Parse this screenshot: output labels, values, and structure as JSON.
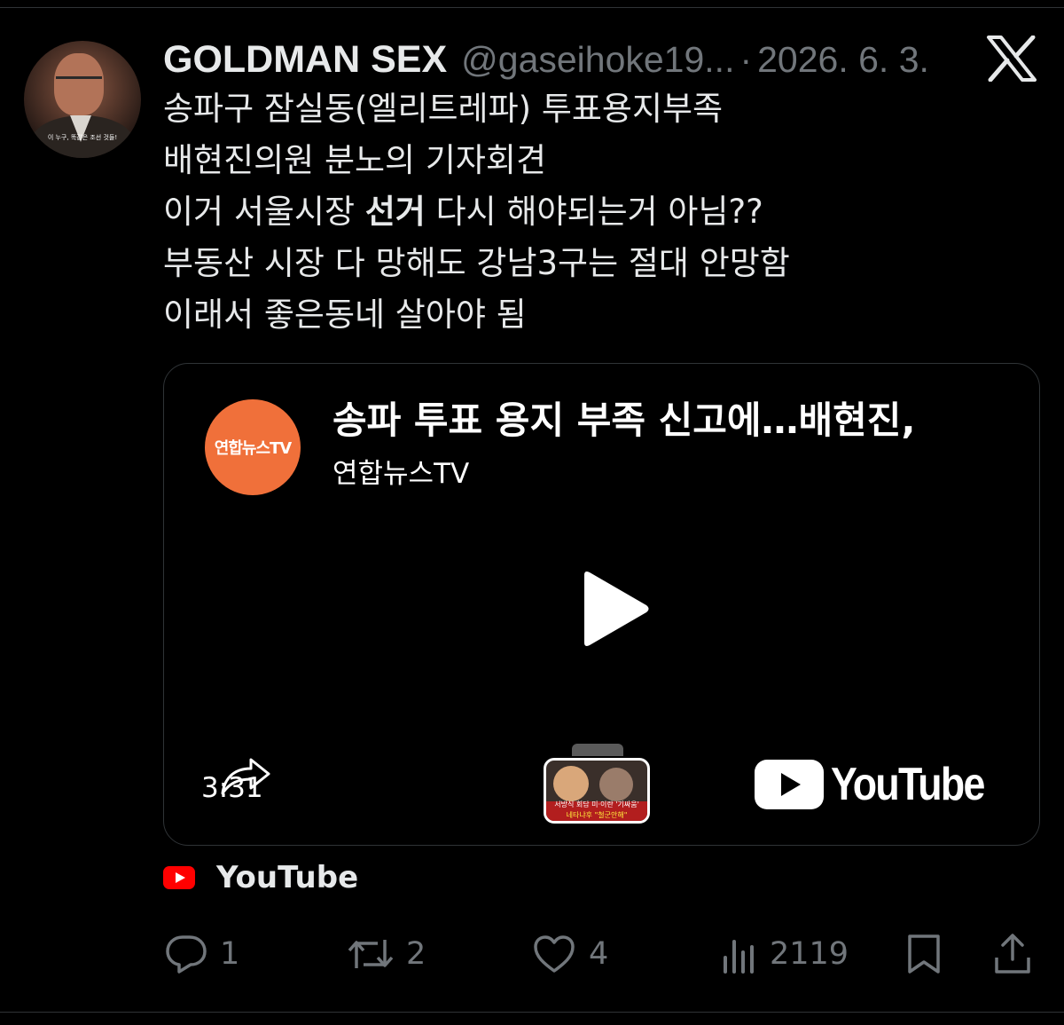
{
  "post": {
    "display_name": "GOLDMAN SEX",
    "handle": "@gaseihoke19...",
    "separator": "·",
    "date": "2026. 6. 3.",
    "avatar_caption": "이 누구, 똑같은 조선 것들!",
    "text_lines": [
      "송파구 잠실동(엘리트레파) 투표용지부족",
      "배현진의원 분노의 기자회견"
    ],
    "line3": {
      "before": "이거 서울시장 ",
      "bold": "선거",
      "after": " 다시 해야되는거 아님??"
    },
    "text_lines_2": [
      "부동산 시장 다 망해도 강남3구는 절대 안망함",
      "이래서 좋은동네 살아야 됨"
    ]
  },
  "video_card": {
    "channel_logo_text": "연합뉴스TV",
    "title": "송파 투표 용지 부족 신고에…배현진,",
    "channel_name": "연합뉴스TV",
    "duration": "3:31",
    "thumbnail_line1": "서방식 회담 미·이란 '기싸움'",
    "thumbnail_line2": "네타냐후 \"철군안해\"",
    "youtube_wordmark": "YouTube"
  },
  "source_label": "YouTube",
  "actions": {
    "replies": "1",
    "reposts": "2",
    "likes": "4",
    "views": "2119"
  },
  "icons": {
    "header": "x-logo-icon",
    "play": "play-icon",
    "share_video": "share-arrow-icon",
    "reply": "reply-icon",
    "repost": "repost-icon",
    "like": "heart-icon",
    "views": "views-icon",
    "bookmark": "bookmark-icon",
    "share": "share-icon"
  },
  "colors": {
    "background": "#000000",
    "text": "#e7e9ea",
    "muted": "#71767b",
    "channel_logo": "#f0703a",
    "youtube_red": "#ff0000"
  }
}
